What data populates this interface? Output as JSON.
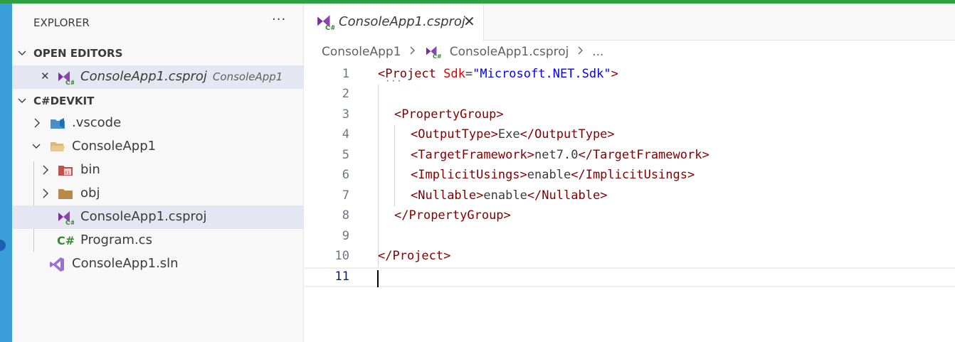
{
  "sidebar": {
    "title": "EXPLORER",
    "more": "···",
    "open_editors": {
      "header": "OPEN EDITORS",
      "items": [
        {
          "close": "✕",
          "label": "ConsoleApp1.csproj",
          "description": "ConsoleApp1"
        }
      ]
    },
    "workspace": {
      "header": "C#DEVKIT",
      "items": [
        {
          "label": ".vscode"
        },
        {
          "label": "ConsoleApp1"
        },
        {
          "label": "bin"
        },
        {
          "label": "obj"
        },
        {
          "label": "ConsoleApp1.csproj"
        },
        {
          "label": "Program.cs"
        },
        {
          "label": "ConsoleApp1.sln"
        }
      ]
    }
  },
  "editor": {
    "tab": {
      "label": "ConsoleApp1.csproj",
      "close": "✕"
    },
    "breadcrumb": {
      "folder": "ConsoleApp1",
      "file": "ConsoleApp1.csproj",
      "more": "..."
    },
    "lines": [
      {
        "num": "1"
      },
      {
        "num": "2"
      },
      {
        "num": "3"
      },
      {
        "num": "4"
      },
      {
        "num": "5"
      },
      {
        "num": "6"
      },
      {
        "num": "7"
      },
      {
        "num": "8"
      },
      {
        "num": "9"
      },
      {
        "num": "10"
      },
      {
        "num": "11"
      }
    ],
    "code": {
      "project_tag": "Project",
      "sdk_attr": "Sdk",
      "sdk_value": "\"Microsoft.NET.Sdk\"",
      "property_group": "PropertyGroup",
      "output_type_tag": "OutputType",
      "output_type_value": "Exe",
      "target_framework_tag": "TargetFramework",
      "target_framework_value": "net7.0",
      "implicit_usings_tag": "ImplicitUsings",
      "implicit_usings_value": "enable",
      "nullable_tag": "Nullable",
      "nullable_value": "enable"
    }
  },
  "colors": {
    "accent_top": "#2ea043",
    "activity_bar": "#3a9fd8",
    "xml_tag": "#800000",
    "xml_attr": "#e50000",
    "xml_value": "#0000ff"
  }
}
